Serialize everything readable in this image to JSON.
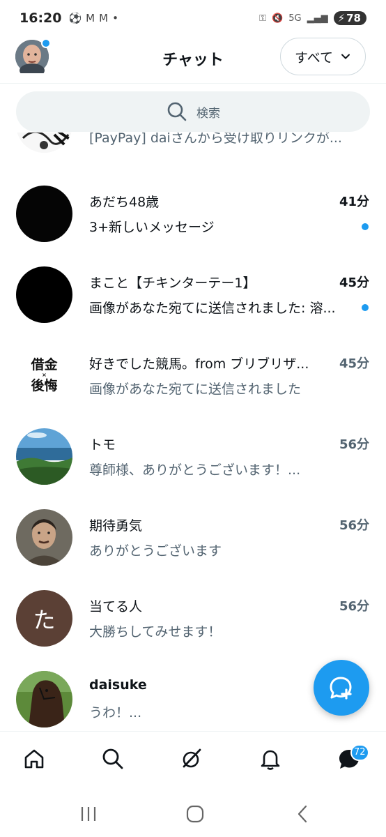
{
  "status_bar": {
    "time": "16:20",
    "left_icons": [
      "soccer-icon",
      "gmail-icon",
      "gmail-icon",
      "dot-icon"
    ],
    "network": "5G",
    "battery": "78"
  },
  "header": {
    "title": "チャット",
    "filter_label": "すべて"
  },
  "search": {
    "placeholder": "検索"
  },
  "chats": [
    {
      "name": "",
      "time": "",
      "preview": "[PayPay] daiさんから受け取りリンクが...",
      "unread": false,
      "avatar": "manga-image"
    },
    {
      "name": "あだち48歳",
      "time": "41分",
      "preview": "3+新しいメッセージ",
      "unread": true,
      "avatar": "black-circle"
    },
    {
      "name": "まこと【チキンターテー1】",
      "time": "45分",
      "preview": "画像があなた宛てに送信されました: 溶...",
      "unread": true,
      "avatar": "black-circle"
    },
    {
      "name": "好きでした競馬。from ブリブリザ...",
      "time": "45分",
      "preview": "画像があなた宛てに送信されました",
      "unread": false,
      "avatar": "text-logo",
      "avatar_text_top": "借金",
      "avatar_text_bottom": "後悔"
    },
    {
      "name": "トモ",
      "time": "56分",
      "preview": "尊師様、ありがとうございます！...",
      "unread": false,
      "avatar": "seaside-photo"
    },
    {
      "name": "期待勇気",
      "time": "56分",
      "preview": "ありがとうございます",
      "unread": false,
      "avatar": "person-photo"
    },
    {
      "name": "当てる人",
      "time": "56分",
      "preview": "大勝ちしてみせます！",
      "unread": false,
      "avatar": "letter",
      "avatar_letter": "た"
    },
    {
      "name": "daisuke",
      "time": "",
      "preview": "うわ！...",
      "unread": false,
      "avatar": "horse-photo"
    }
  ],
  "bottom_nav": {
    "items": [
      "home-icon",
      "search-icon",
      "grok-icon",
      "bell-icon",
      "messages-icon"
    ],
    "messages_badge": "72"
  },
  "colors": {
    "accent": "#1d9bf0",
    "text_primary": "#0f1419",
    "text_secondary": "#536471",
    "letter_avatar": "#5b4035"
  }
}
